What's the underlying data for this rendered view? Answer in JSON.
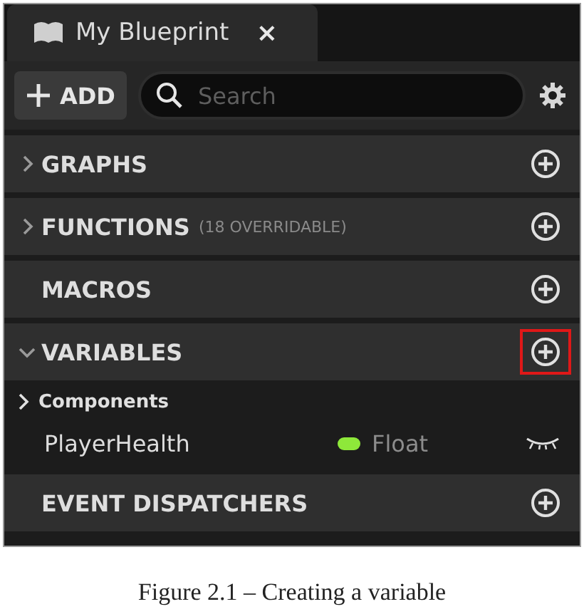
{
  "tab": {
    "title": "My Blueprint",
    "close": "×"
  },
  "toolbar": {
    "add_label": "ADD",
    "search": {
      "placeholder": "Search"
    }
  },
  "sections": [
    {
      "title": "GRAPHS",
      "expanded": false,
      "highlighted": false
    },
    {
      "title": "FUNCTIONS",
      "note": "(18 OVERRIDABLE)",
      "expanded": false,
      "highlighted": false
    },
    {
      "title": "MACROS",
      "highlighted": false
    },
    {
      "title": "VARIABLES",
      "expanded": true,
      "highlighted": true,
      "children": [
        {
          "kind": "category",
          "label": "Components",
          "expanded": false
        },
        {
          "kind": "variable",
          "label": "PlayerHealth",
          "type": "Float",
          "color": "#8ee83a"
        }
      ]
    },
    {
      "title": "EVENT DISPATCHERS",
      "highlighted": false
    }
  ],
  "caption": "Figure 2.1 – Creating a variable"
}
